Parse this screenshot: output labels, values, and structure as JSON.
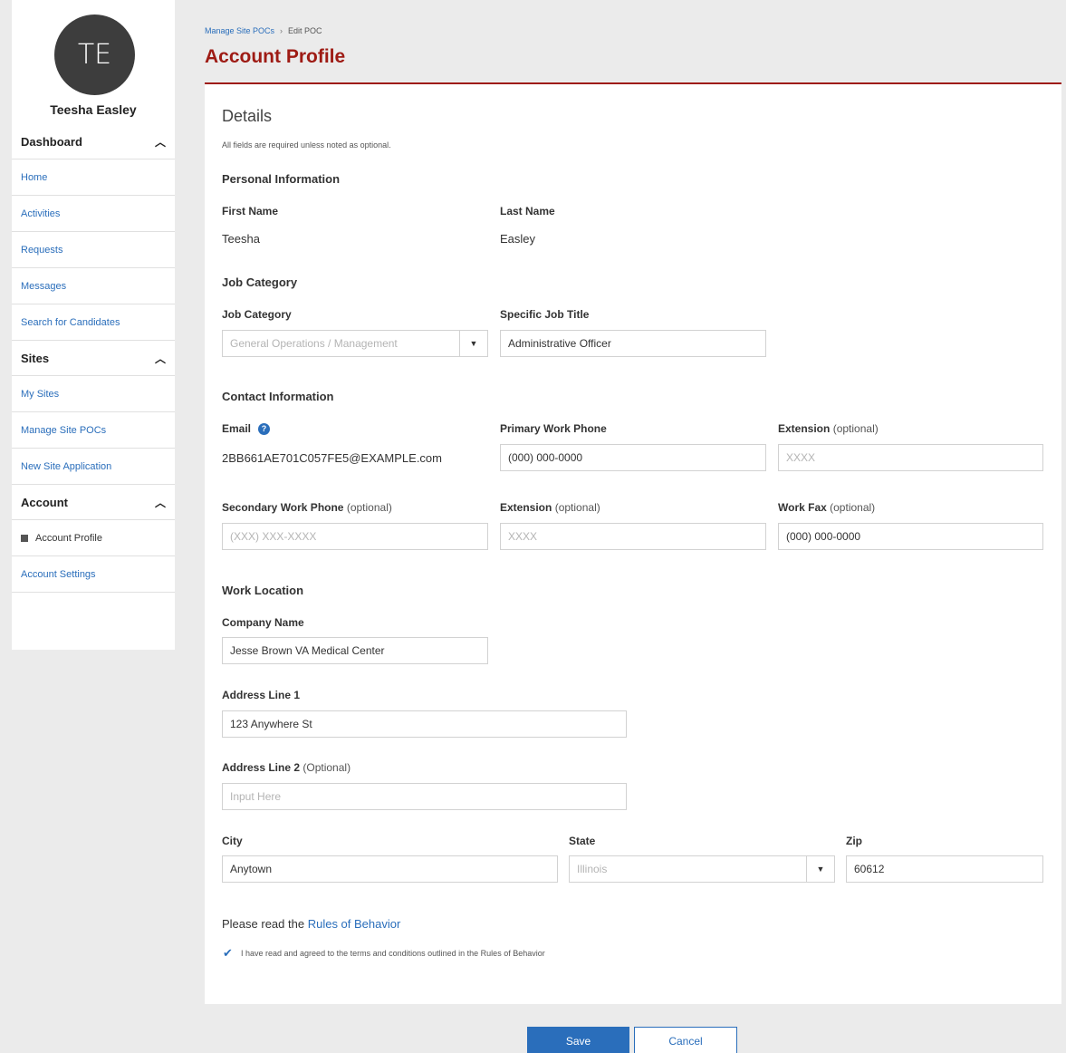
{
  "sidebar": {
    "avatar_initials": "TE",
    "user_name": "Teesha Easley",
    "sections": [
      {
        "label": "Dashboard",
        "items": [
          "Home",
          "Activities",
          "Requests",
          "Messages",
          "Search for Candidates"
        ]
      },
      {
        "label": "Sites",
        "items": [
          "My Sites",
          "Manage Site POCs",
          "New Site Application"
        ]
      },
      {
        "label": "Account",
        "items": [
          "Account Profile",
          "Account Settings"
        ]
      }
    ]
  },
  "breadcrumb": {
    "parent": "Manage Site POCs",
    "current": "Edit POC"
  },
  "page_title": "Account Profile",
  "form": {
    "heading": "Details",
    "required_note": "All fields are required unless noted as optional.",
    "personal": {
      "title": "Personal Information",
      "first_name_label": "First Name",
      "first_name": "Teesha",
      "last_name_label": "Last Name",
      "last_name": "Easley"
    },
    "job": {
      "title": "Job Category",
      "category_label": "Job Category",
      "category_value": "General Operations / Management",
      "title_label": "Specific Job Title",
      "title_value": "Administrative Officer"
    },
    "contact": {
      "title": "Contact Information",
      "email_label": "Email",
      "email_value": "2BB661AE701C057FE5@EXAMPLE.com",
      "primary_phone_label": "Primary Work Phone",
      "primary_phone_placeholder": "(000) 000-0000",
      "ext_label": "Extension",
      "optional": "(optional)",
      "ext_placeholder": "XXXX",
      "secondary_phone_label": "Secondary Work Phone",
      "secondary_phone_placeholder": "(XXX) XXX-XXXX",
      "ext2_placeholder": "XXXX",
      "fax_label": "Work Fax",
      "fax_value": "(000) 000-0000"
    },
    "location": {
      "title": "Work Location",
      "company_label": "Company Name",
      "company_value": "Jesse Brown VA Medical Center",
      "address1_label": "Address Line 1",
      "address1_value": "123 Anywhere St",
      "address2_label": "Address Line 2",
      "address2_optional": "(Optional)",
      "address2_placeholder": "Input Here",
      "city_label": "City",
      "city_value": "Anytown",
      "state_label": "State",
      "state_value": "Illinois",
      "zip_label": "Zip",
      "zip_value": "60612"
    },
    "rules_prefix": "Please read the",
    "rules_link": "Rules of Behavior",
    "agree_text": "I have read and agreed to the terms and conditions outlined in the Rules of Behavior",
    "agree_checked": true
  },
  "buttons": {
    "save": "Save",
    "cancel": "Cancel"
  },
  "colors": {
    "accent": "#9e1b14",
    "link": "#2a6ebb",
    "background": "#ebebeb"
  }
}
